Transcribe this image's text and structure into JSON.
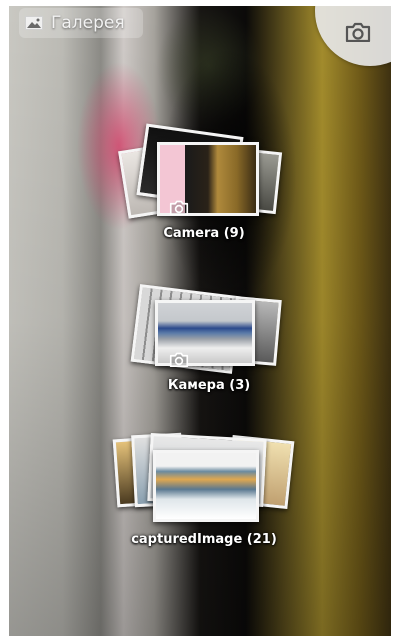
{
  "header": {
    "title": "Галерея",
    "title_icon": "gallery-icon",
    "camera_icon": "camera-icon"
  },
  "albums": [
    {
      "name": "Camera",
      "count": "(9)",
      "label": "Camera  (9)",
      "icon": "camera-icon"
    },
    {
      "name": "Камера",
      "count": "(3)",
      "label": "Камера  (3)",
      "icon": "camera-icon"
    },
    {
      "name": "capturedImage",
      "count": "(21)",
      "label": "capturedImage  (21)"
    }
  ],
  "colors": {
    "title_pill_bg": "#ffffff",
    "label_text": "#ffffff",
    "photo_border": "#f5f5f5"
  }
}
